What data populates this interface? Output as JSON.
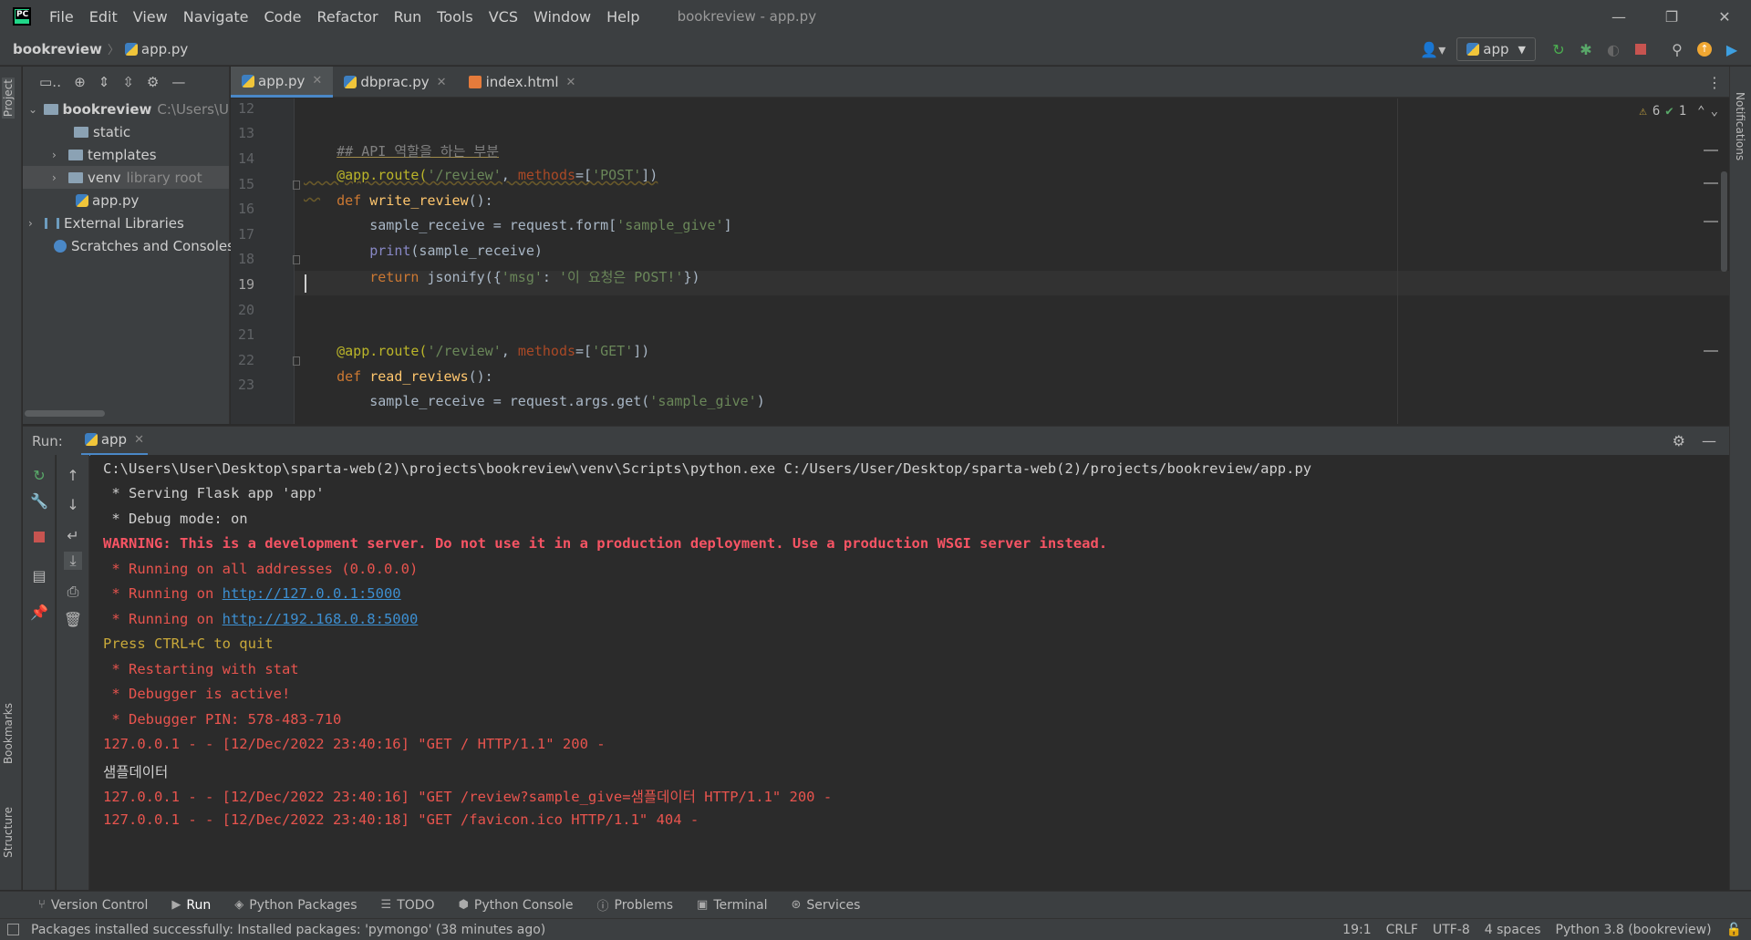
{
  "window": {
    "title": "bookreview - app.py",
    "menu": [
      "File",
      "Edit",
      "View",
      "Navigate",
      "Code",
      "Refactor",
      "Run",
      "Tools",
      "VCS",
      "Window",
      "Help"
    ]
  },
  "breadcrumb": {
    "project": "bookreview",
    "file": "app.py"
  },
  "run_config": {
    "label": "app"
  },
  "side_tabs": {
    "project": "Project",
    "bookmarks": "Bookmarks",
    "structure": "Structure",
    "notifications": "Notifications"
  },
  "project_tree": {
    "root_name": "bookreview",
    "root_path": "C:\\Users\\U",
    "static": "static",
    "templates": "templates",
    "venv": "venv",
    "venv_hint": "library root",
    "app_py": "app.py",
    "external_libraries": "External Libraries",
    "scratches": "Scratches and Consoles"
  },
  "editor_tabs": [
    "app.py",
    "dbprac.py",
    "index.html"
  ],
  "inspections": {
    "warnings": "6",
    "typos": "1"
  },
  "editor": {
    "line_numbers": [
      "12",
      "13",
      "14",
      "15",
      "16",
      "17",
      "18",
      "19",
      "20",
      "21",
      "22",
      "23"
    ],
    "l13_comment": "## API 역할을 하는 부분",
    "l14_deco": "@app.route(",
    "l14_str": "'/review'",
    "l14_sep": ", ",
    "l14_param": "methods",
    "l14_eq": "=[",
    "l14_str2": "'POST'",
    "l14_end": "])",
    "l15_kw": "def ",
    "l15_fn": "write_review",
    "l15_end": "():",
    "l16_pre": "    sample_receive = request.form[",
    "l16_str": "'sample_give'",
    "l16_end": "]",
    "l17_pre": "    ",
    "l17_builtin": "print",
    "l17_end": "(sample_receive)",
    "l18_pre": "    ",
    "l18_kw": "return",
    "l18_mid": " jsonify({",
    "l18_str1": "'msg'",
    "l18_colon": ": ",
    "l18_str2": "'이 요청은 POST!'",
    "l18_end": "})",
    "l21_deco": "@app.route(",
    "l21_str": "'/review'",
    "l21_sep": ", ",
    "l21_param": "methods",
    "l21_eq": "=[",
    "l21_str2": "'GET'",
    "l21_end": "])",
    "l22_kw": "def ",
    "l22_fn": "read_reviews",
    "l22_end": "():",
    "l23_pre": "    sample_receive = request.args.get(",
    "l23_str": "'sample_give'",
    "l23_end": ")"
  },
  "run_panel": {
    "label": "Run:",
    "tab": "app"
  },
  "console": {
    "cmd": "C:\\Users\\User\\Desktop\\sparta-web(2)\\projects\\bookreview\\venv\\Scripts\\python.exe C:/Users/User/Desktop/sparta-web(2)/projects/bookreview/app.py",
    "serving": " * Serving Flask app 'app'",
    "debug_mode": " * Debug mode: on",
    "warning": "WARNING: This is a development server. Do not use it in a production deployment. Use a production WSGI server instead.",
    "running_all": " * Running on all addresses (0.0.0.0)",
    "running_on_prefix": " * Running on ",
    "url1": "http://127.0.0.1:5000",
    "url2": "http://192.168.0.8:5000",
    "quit": "Press CTRL+C to quit",
    "restarting": " * Restarting with stat",
    "debugger_active": " * Debugger is active!",
    "debugger_pin": " * Debugger PIN: 578-483-710",
    "log1": "127.0.0.1 - - [12/Dec/2022 23:40:16] \"GET / HTTP/1.1\" 200 -",
    "printed": "샘플데이터",
    "log2": "127.0.0.1 - - [12/Dec/2022 23:40:16] \"GET /review?sample_give=샘플데이터 HTTP/1.1\" 200 -",
    "log3": "127.0.0.1 - - [12/Dec/2022 23:40:18] \"GET /favicon.ico HTTP/1.1\" 404 -"
  },
  "bottom_tabs": [
    "Version Control",
    "Run",
    "Python Packages",
    "TODO",
    "Python Console",
    "Problems",
    "Terminal",
    "Services"
  ],
  "status": {
    "message": "Packages installed successfully: Installed packages: 'pymongo' (38 minutes ago)",
    "position": "19:1",
    "line_sep": "CRLF",
    "encoding": "UTF-8",
    "indent": "4 spaces",
    "interpreter": "Python 3.8 (bookreview)"
  },
  "colors": {
    "accent": "#4a88c7",
    "bg": "#2b2b2b",
    "panel": "#3c3f41",
    "error_text": "#e8544e"
  }
}
